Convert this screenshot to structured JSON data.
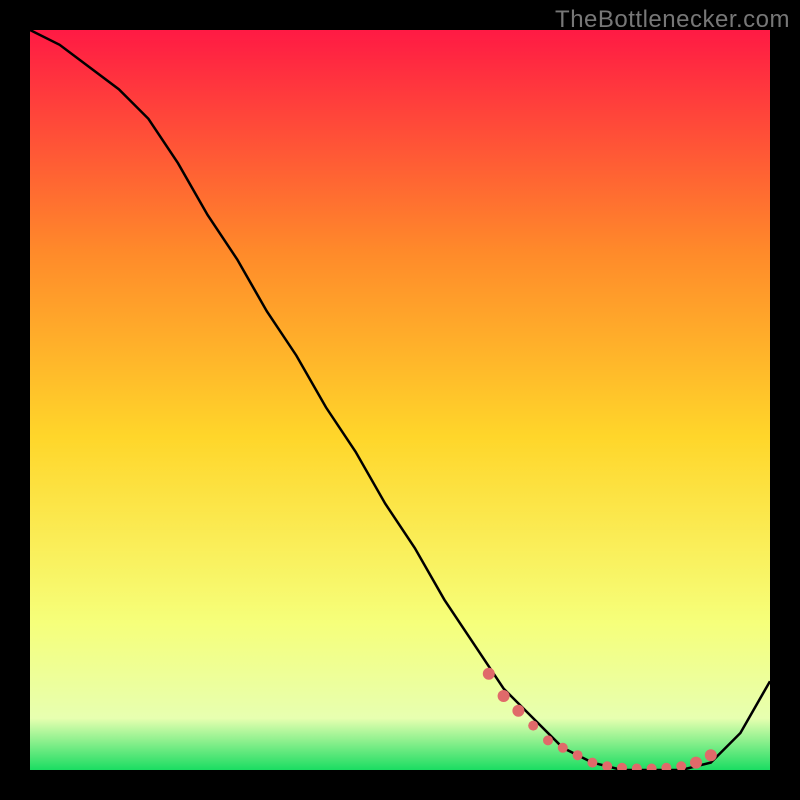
{
  "watermark": "TheBottlenecker.com",
  "chart_data": {
    "type": "line",
    "title": "",
    "xlabel": "",
    "ylabel": "",
    "xlim": [
      0,
      100
    ],
    "ylim": [
      0,
      100
    ],
    "background_gradient": {
      "top": "#ff1a44",
      "upper_mid": "#ff8a2a",
      "mid": "#ffd62a",
      "lower_mid": "#f6ff7a",
      "near_bottom": "#e7ffb0",
      "bottom": "#1add62"
    },
    "series": [
      {
        "name": "bottleneck-curve",
        "stroke": "#000000",
        "x": [
          0,
          4,
          8,
          12,
          16,
          20,
          24,
          28,
          32,
          36,
          40,
          44,
          48,
          52,
          56,
          60,
          64,
          68,
          72,
          76,
          80,
          84,
          88,
          92,
          96,
          100
        ],
        "y": [
          100,
          98,
          95,
          92,
          88,
          82,
          75,
          69,
          62,
          56,
          49,
          43,
          36,
          30,
          23,
          17,
          11,
          7,
          3,
          1,
          0,
          0,
          0,
          1,
          5,
          12
        ]
      }
    ],
    "markers": {
      "name": "sample-points",
      "color": "#e06a6a",
      "x": [
        62,
        64,
        66,
        68,
        70,
        72,
        74,
        76,
        78,
        80,
        82,
        84,
        86,
        88,
        90,
        92
      ],
      "y": [
        13,
        10,
        8,
        6,
        4,
        3,
        2,
        1,
        0.5,
        0.3,
        0.2,
        0.2,
        0.3,
        0.5,
        1,
        2
      ]
    }
  }
}
